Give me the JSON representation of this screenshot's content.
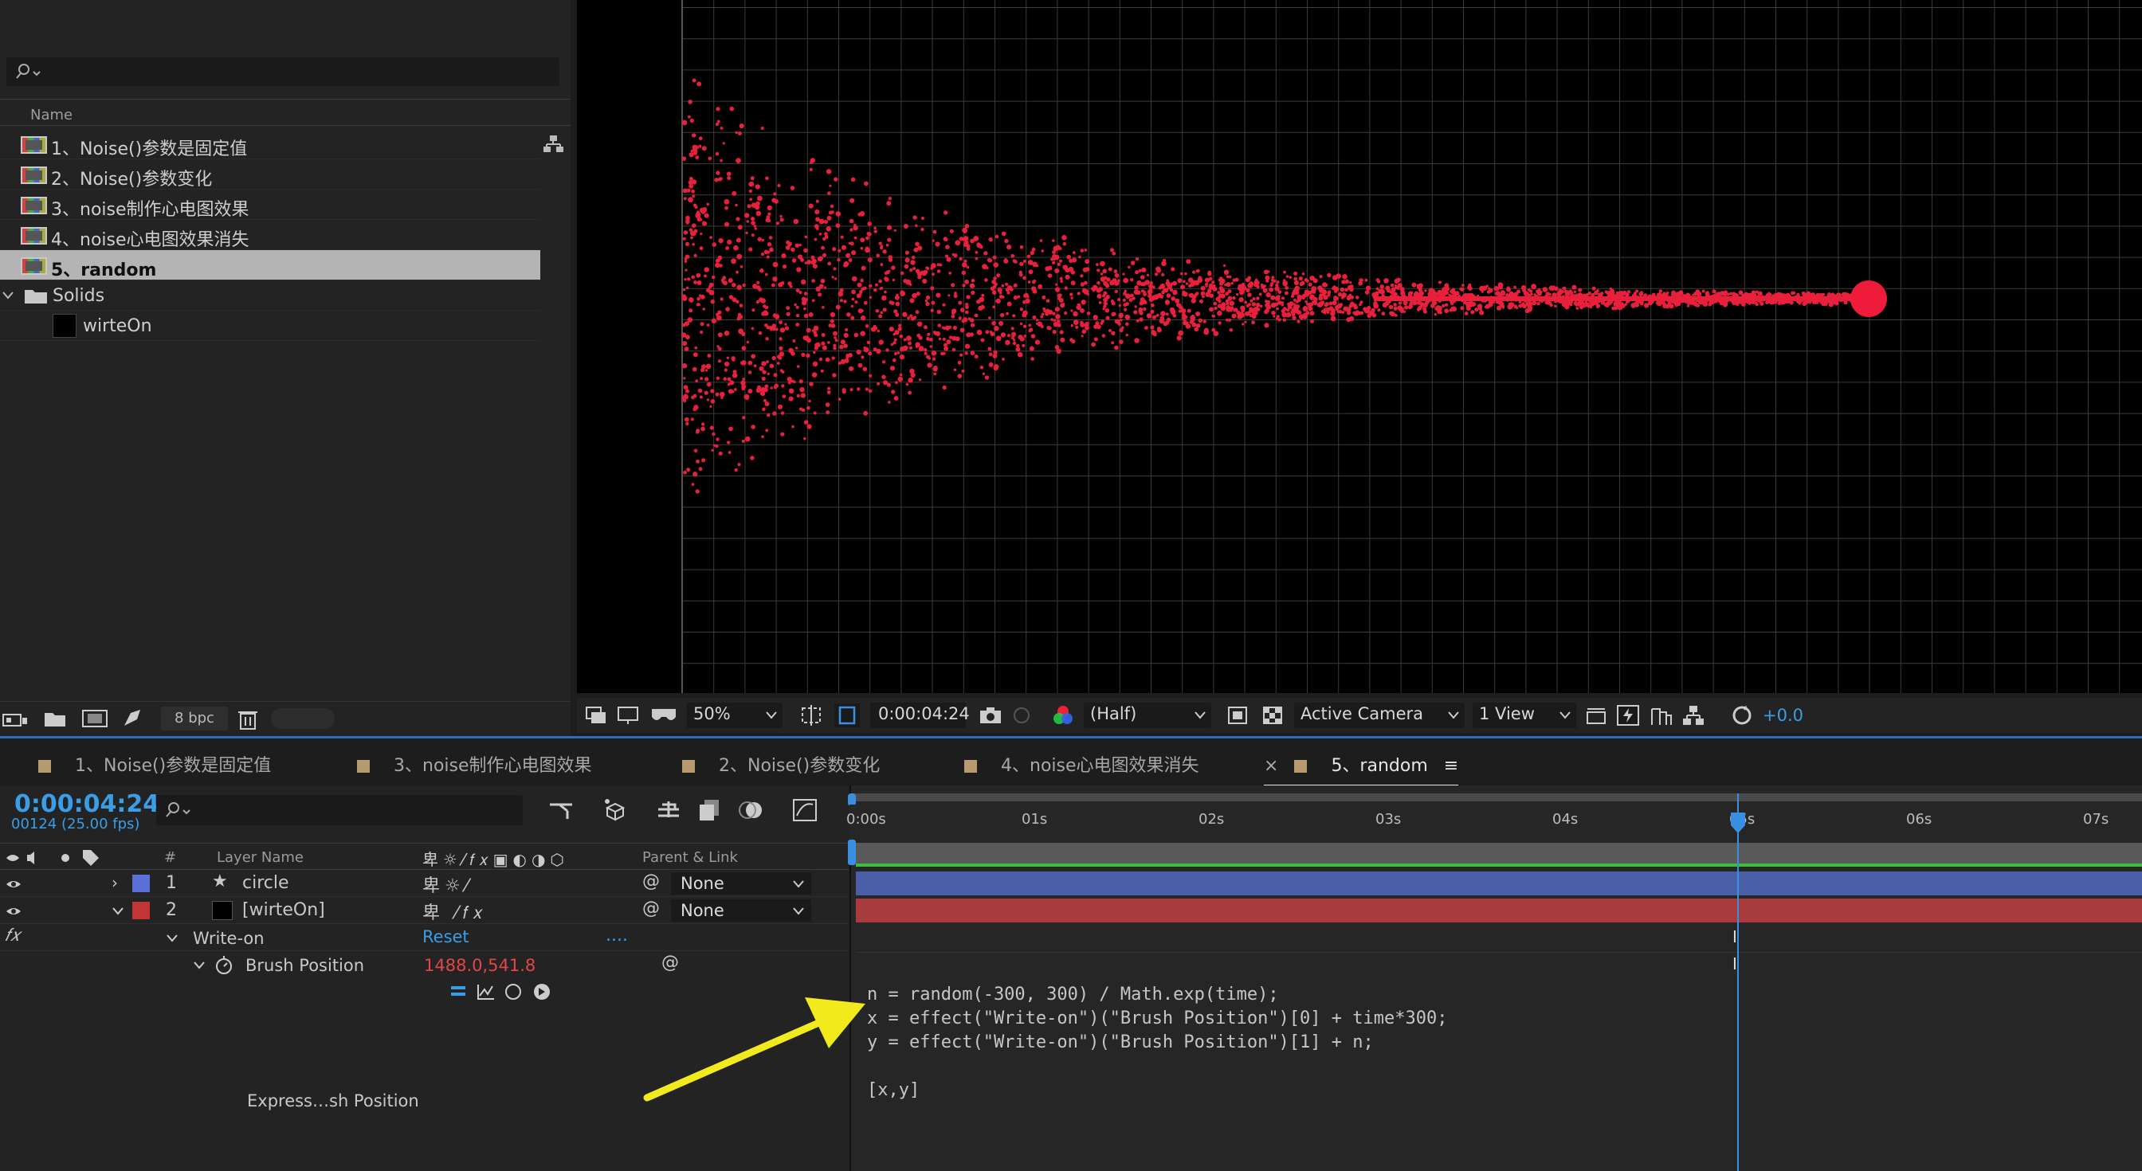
{
  "project": {
    "search_placeholder": "",
    "column_name": "Name",
    "items": [
      {
        "label": "1、Noise()参数是固定值"
      },
      {
        "label": "2、Noise()参数变化"
      },
      {
        "label": "3、noise制作心电图效果"
      },
      {
        "label": "4、noise心电图效果消失"
      },
      {
        "label": "5、random"
      }
    ],
    "folder": "Solids",
    "solid": "wirteOn",
    "bpc": "8 bpc"
  },
  "viewer": {
    "zoom": "50%",
    "timecode": "0:00:04:24",
    "resolution": "(Half)",
    "camera": "Active Camera",
    "views": "1 View",
    "exposure": "+0.0"
  },
  "tabs": [
    {
      "label": "1、Noise()参数是固定值"
    },
    {
      "label": "3、noise制作心电图效果"
    },
    {
      "label": "2、Noise()参数变化"
    },
    {
      "label": "4、noise心电图效果消失"
    },
    {
      "label": "5、random",
      "active": true
    }
  ],
  "timeline": {
    "timecode": "0:00:04:24",
    "frames": "00124 (25.00 fps)",
    "col_layer_name": "Layer Name",
    "col_hash": "#",
    "col_parent": "Parent & Link",
    "layers": [
      {
        "num": "1",
        "name": "circle",
        "parent": "None",
        "color": "#5a6fd8"
      },
      {
        "num": "2",
        "name": "[wirteOn]",
        "parent": "None",
        "color": "#c03636"
      }
    ],
    "effect": "Write-on",
    "reset": "Reset",
    "reset_more": "....",
    "property": "Brush Position",
    "property_value": "1488.0,541.8",
    "expr_label": "Express…sh Position",
    "ticks": [
      "0:00s",
      "01s",
      "02s",
      "03s",
      "04s",
      "05s",
      "06s",
      "07s"
    ],
    "code": "n = random(-300, 300) / Math.exp(time);\nx = effect(\"Write-on\")(\"Brush Position\")[0] + time*300;\ny = effect(\"Write-on\")(\"Brush Position\")[1] + n;\n\n[x,y]",
    "colors": {
      "accent": "#3a9ee6",
      "layer1": "#4a5fa8",
      "layer2": "#a83c3c",
      "work_area": "#3cc03c"
    }
  }
}
